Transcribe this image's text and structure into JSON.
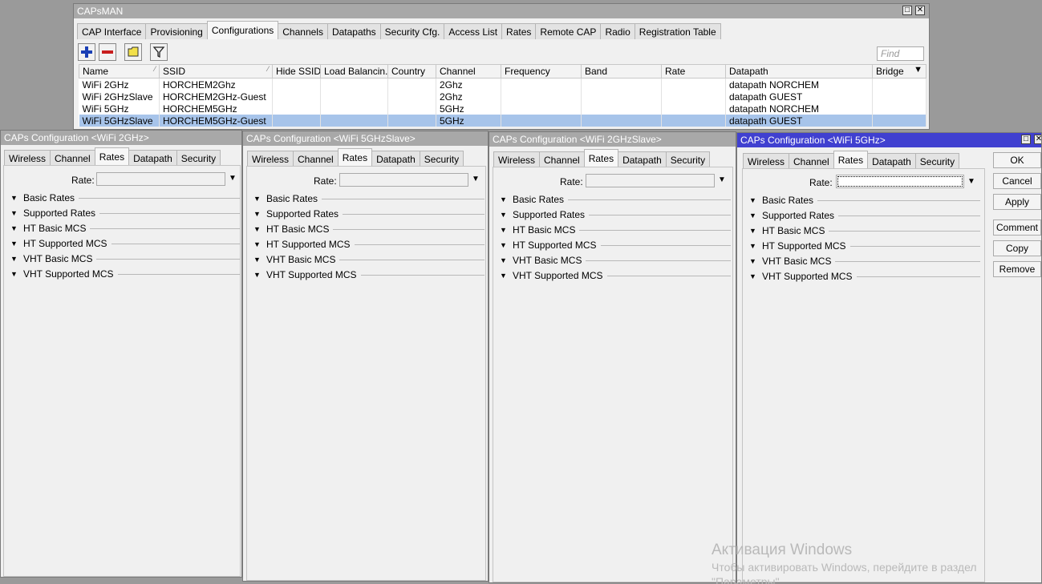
{
  "main": {
    "title": "CAPsMAN",
    "tabs": [
      {
        "label": "CAP Interface"
      },
      {
        "label": "Provisioning"
      },
      {
        "label": "Configurations",
        "active": true
      },
      {
        "label": "Channels"
      },
      {
        "label": "Datapaths"
      },
      {
        "label": "Security Cfg."
      },
      {
        "label": "Access List"
      },
      {
        "label": "Rates"
      },
      {
        "label": "Remote CAP"
      },
      {
        "label": "Radio"
      },
      {
        "label": "Registration Table"
      }
    ],
    "toolbar_icons": [
      "add-icon",
      "remove-icon",
      "comment-icon",
      "filter-icon"
    ],
    "find_placeholder": "Find",
    "columns": [
      "Name",
      "SSID",
      "Hide SSID",
      "Load Balancin...",
      "Country",
      "Channel",
      "Frequency",
      "Band",
      "Rate",
      "Datapath",
      "Bridge"
    ],
    "rows": [
      {
        "name": "WiFi 2GHz",
        "ssid": "HORCHEM2Ghz",
        "hide_ssid": "",
        "load_balancing": "",
        "country": "",
        "channel": "2Ghz",
        "frequency": "",
        "band": "",
        "rate": "",
        "datapath": "datapath NORCHEM",
        "bridge": ""
      },
      {
        "name": "WiFi 2GHzSlave",
        "ssid": "HORCHEM2GHz-Guest",
        "hide_ssid": "",
        "load_balancing": "",
        "country": "",
        "channel": "2Ghz",
        "frequency": "",
        "band": "",
        "rate": "",
        "datapath": "datapath GUEST",
        "bridge": ""
      },
      {
        "name": "WiFi 5GHz",
        "ssid": "HORCHEM5GHz",
        "hide_ssid": "",
        "load_balancing": "",
        "country": "",
        "channel": "5GHz",
        "frequency": "",
        "band": "",
        "rate": "",
        "datapath": "datapath NORCHEM",
        "bridge": ""
      },
      {
        "name": "WiFi 5GHzSlave",
        "ssid": "HORCHEM5GHz-Guest",
        "hide_ssid": "",
        "load_balancing": "",
        "country": "",
        "channel": "5GHz",
        "frequency": "",
        "band": "",
        "rate": "",
        "datapath": "datapath GUEST",
        "bridge": "",
        "selected": true
      }
    ]
  },
  "config_windows": [
    {
      "title": "CAPs Configuration <WiFi 2GHz>",
      "active": false
    },
    {
      "title": "CAPs Configuration <WiFi 5GHzSlave>",
      "active": false
    },
    {
      "title": "CAPs Configuration <WiFi 2GHzSlave>",
      "active": false
    },
    {
      "title": "CAPs Configuration <WiFi 5GHz>",
      "active": true
    }
  ],
  "config_tabs": [
    "Wireless",
    "Channel",
    "Rates",
    "Datapath",
    "Security"
  ],
  "config_active_tab": "Rates",
  "rate_label": "Rate:",
  "rate_value": "",
  "sections": [
    "Basic Rates",
    "Supported Rates",
    "HT Basic MCS",
    "HT Supported MCS",
    "VHT Basic MCS",
    "VHT Supported MCS"
  ],
  "side_buttons": [
    "OK",
    "Cancel",
    "Apply",
    "Comment",
    "Copy",
    "Remove"
  ],
  "watermark": {
    "line1": "Активация Windows",
    "line2": "Чтобы активировать Windows, перейдите в раздел",
    "line3": "\"Параметры\"."
  },
  "colors": {
    "active_title": "#4040d0",
    "inactive_title": "#a8a8a8",
    "selected_row": "#a7c4ea",
    "desktop": "#9a9a9a",
    "add_icon": "#1a3fb5",
    "remove_icon": "#c81e1e"
  }
}
